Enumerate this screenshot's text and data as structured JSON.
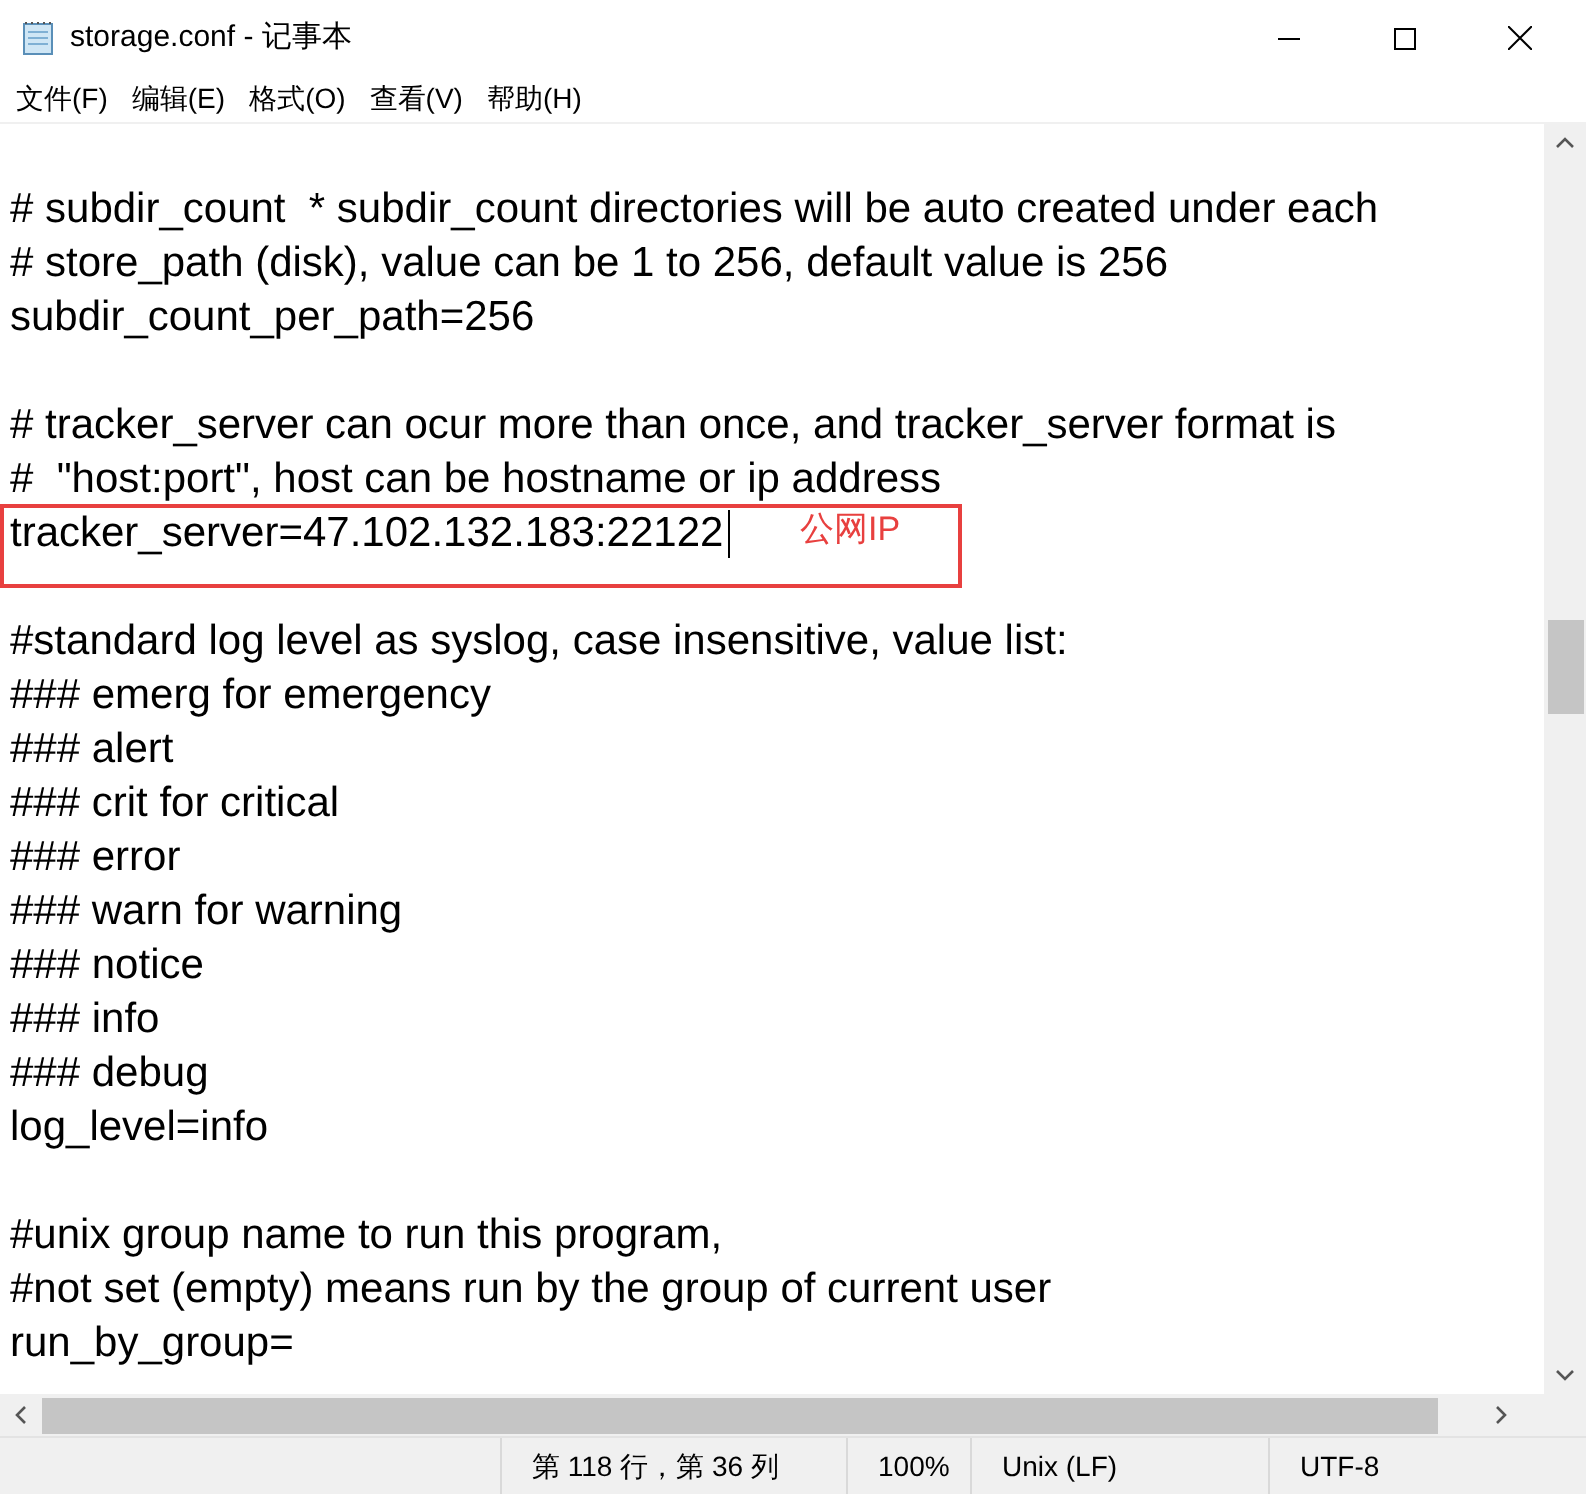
{
  "window": {
    "title": "storage.conf - 记事本"
  },
  "menu": [
    "文件(F)",
    "编辑(E)",
    "格式(O)",
    "查看(V)",
    "帮助(H)"
  ],
  "lines": [
    {
      "kind": "blank"
    },
    {
      "kind": "text",
      "text": "# subdir_count  * subdir_count directories will be auto created under each"
    },
    {
      "kind": "text",
      "text": "# store_path (disk), value can be 1 to 256, default value is 256"
    },
    {
      "kind": "text",
      "text": "subdir_count_per_path=256"
    },
    {
      "kind": "blank"
    },
    {
      "kind": "text",
      "text": "# tracker_server can ocur more than once, and tracker_server format is"
    },
    {
      "kind": "text",
      "text": "#  \"host:port\", host can be hostname or ip address"
    },
    {
      "kind": "text",
      "text": "tracker_server=47.102.132.183:22122",
      "cursor": true
    },
    {
      "kind": "blank"
    },
    {
      "kind": "text",
      "text": "#standard log level as syslog, case insensitive, value list:"
    },
    {
      "kind": "text",
      "text": "### emerg for emergency"
    },
    {
      "kind": "text",
      "text": "### alert"
    },
    {
      "kind": "text",
      "text": "### crit for critical"
    },
    {
      "kind": "text",
      "text": "### error"
    },
    {
      "kind": "text",
      "text": "### warn for warning"
    },
    {
      "kind": "text",
      "text": "### notice"
    },
    {
      "kind": "text",
      "text": "### info"
    },
    {
      "kind": "text",
      "text": "### debug"
    },
    {
      "kind": "text",
      "text": "log_level=info"
    },
    {
      "kind": "blank"
    },
    {
      "kind": "text",
      "text": "#unix group name to run this program,"
    },
    {
      "kind": "text",
      "text": "#not set (empty) means run by the group of current user"
    },
    {
      "kind": "text",
      "text": "run_by_group="
    }
  ],
  "annotation": {
    "label": "公网IP"
  },
  "status_bar": [
    "第 118 行，第 36 列",
    "100%",
    "Unix (LF)",
    "UTF-8"
  ]
}
